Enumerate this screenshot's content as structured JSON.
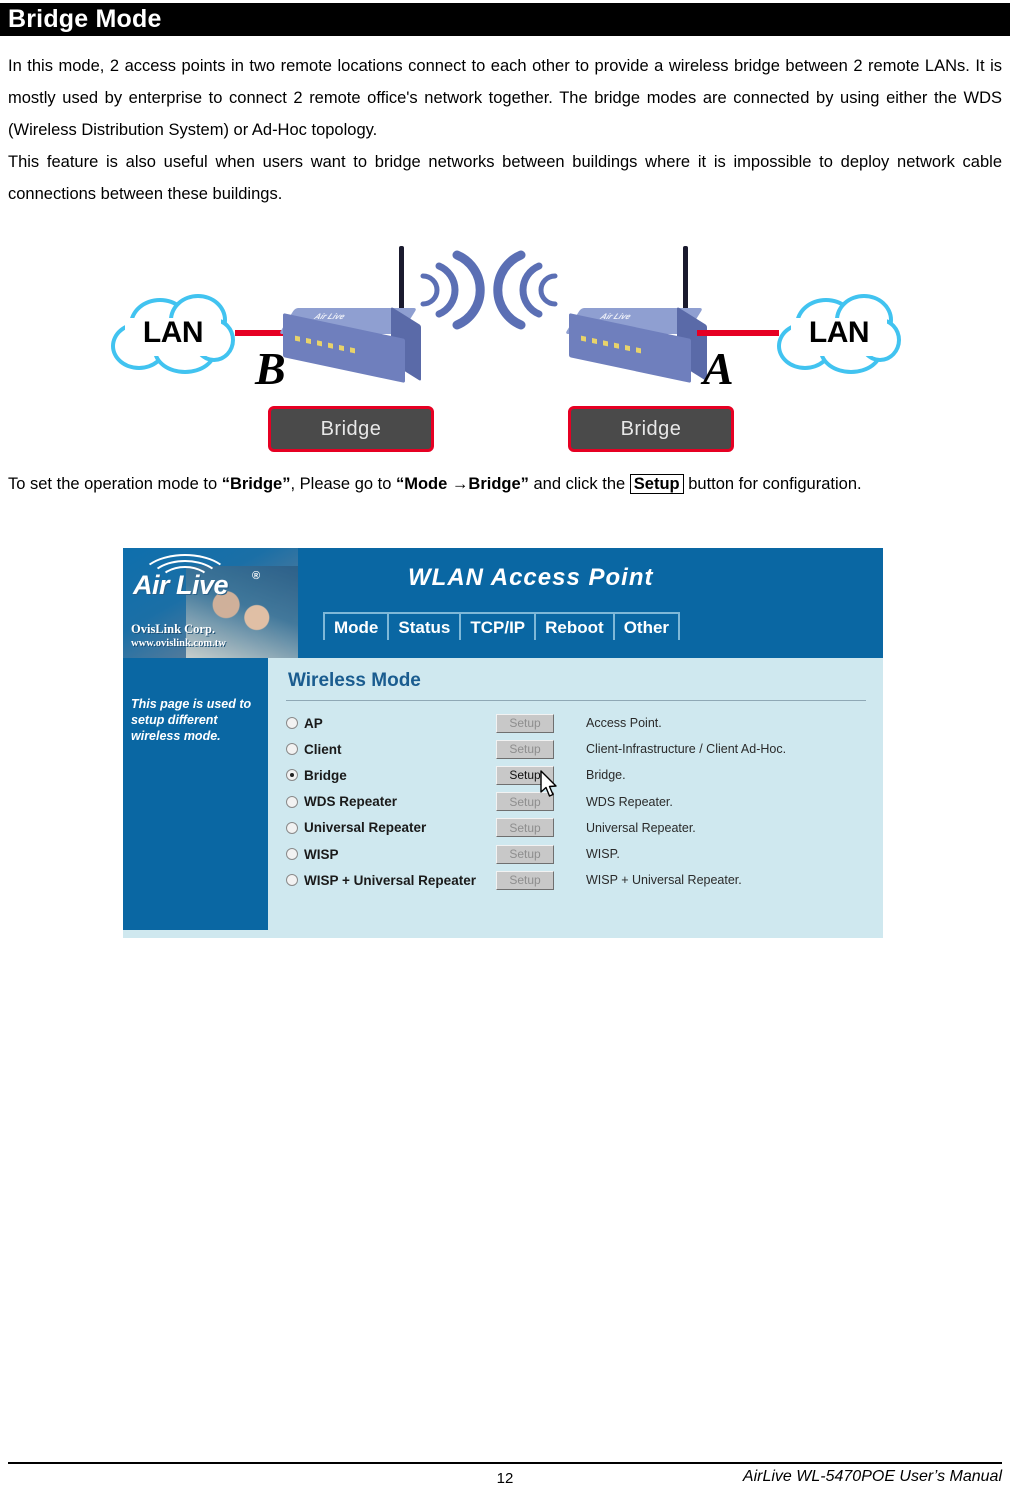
{
  "page": {
    "heading": "Bridge Mode",
    "paragraphs": [
      "In this mode, 2 access points in two remote locations connect to each other to provide a wireless bridge between 2 remote LANs. It is mostly used by enterprise to connect 2 remote office's network together. The bridge modes are connected by using either the WDS (Wireless Distribution System) or Ad-Hoc topology.",
      "This feature is also useful when users want to bridge networks between buildings where it is impossible to deploy network cable connections between these buildings."
    ],
    "instruction": {
      "part1": "To set the operation mode to ",
      "mode_quoted": "“Bridge”",
      "part2": ", Please go to ",
      "path_quoted": "“Mode →Bridge”",
      "part3": " and click the ",
      "button_label": "Setup",
      "part4": " button for configuration."
    }
  },
  "diagram": {
    "cloud_left_label": "LAN",
    "cloud_right_label": "LAN",
    "device_left_letter": "B",
    "device_right_letter": "A",
    "badge_left_label": "Bridge",
    "badge_right_label": "Bridge"
  },
  "webui": {
    "brand": {
      "name": "Air Live",
      "registered": "®",
      "company": "OvisLink Corp.",
      "url": "www.ovislink.com.tw"
    },
    "title": "WLAN Access Point",
    "tabs": [
      {
        "label": "Mode"
      },
      {
        "label": "Status"
      },
      {
        "label": "TCP/IP"
      },
      {
        "label": "Reboot"
      },
      {
        "label": "Other"
      }
    ],
    "side_note": "This page is used to setup different wireless mode.",
    "section_title": "Wireless Mode",
    "setup_button_label": "Setup",
    "modes": [
      {
        "label": "AP",
        "selected": false,
        "enabled": false,
        "description": "Access Point."
      },
      {
        "label": "Client",
        "selected": false,
        "enabled": false,
        "description": "Client-Infrastructure / Client Ad-Hoc."
      },
      {
        "label": "Bridge",
        "selected": true,
        "enabled": true,
        "description": "Bridge."
      },
      {
        "label": "WDS Repeater",
        "selected": false,
        "enabled": false,
        "description": "WDS Repeater."
      },
      {
        "label": "Universal Repeater",
        "selected": false,
        "enabled": false,
        "description": "Universal Repeater."
      },
      {
        "label": "WISP",
        "selected": false,
        "enabled": false,
        "description": "WISP."
      },
      {
        "label": "WISP + Universal Repeater",
        "selected": false,
        "enabled": false,
        "description": "WISP + Universal Repeater."
      }
    ]
  },
  "footer": {
    "page_number": "12",
    "manual_label": "AirLive WL-5470POE User’s Manual"
  },
  "colors": {
    "title_bar": "#000000",
    "ui_header_blue": "#0a67a3",
    "ui_body_blue": "#cfe8ef",
    "section_heading": "#1a5c8f",
    "link_red": "#e60023",
    "cloud_outline": "#41c3f0",
    "wave_blue": "#5b6fb4"
  }
}
